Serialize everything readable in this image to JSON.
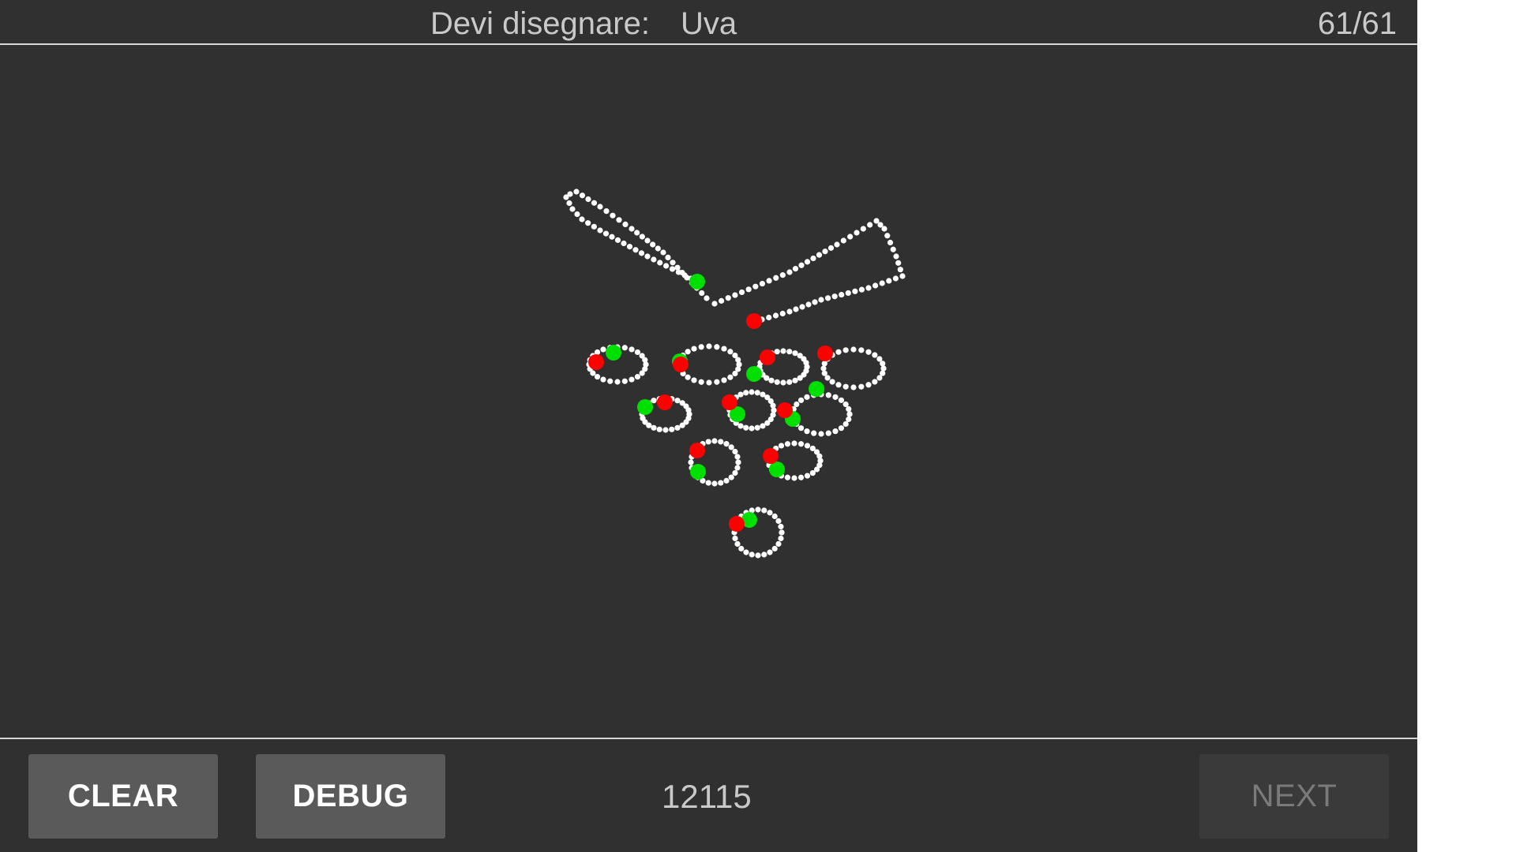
{
  "header": {
    "prompt_label": "Devi disegnare:",
    "prompt_word": "Uva",
    "counter": "61/61"
  },
  "footer": {
    "clear_label": "CLEAR",
    "debug_label": "DEBUG",
    "score": "12115",
    "next_label": "NEXT"
  },
  "colors": {
    "background": "#303030",
    "stroke_point": "#ffffff",
    "stroke_start": "#00e000",
    "stroke_end": "#ff0000"
  }
}
